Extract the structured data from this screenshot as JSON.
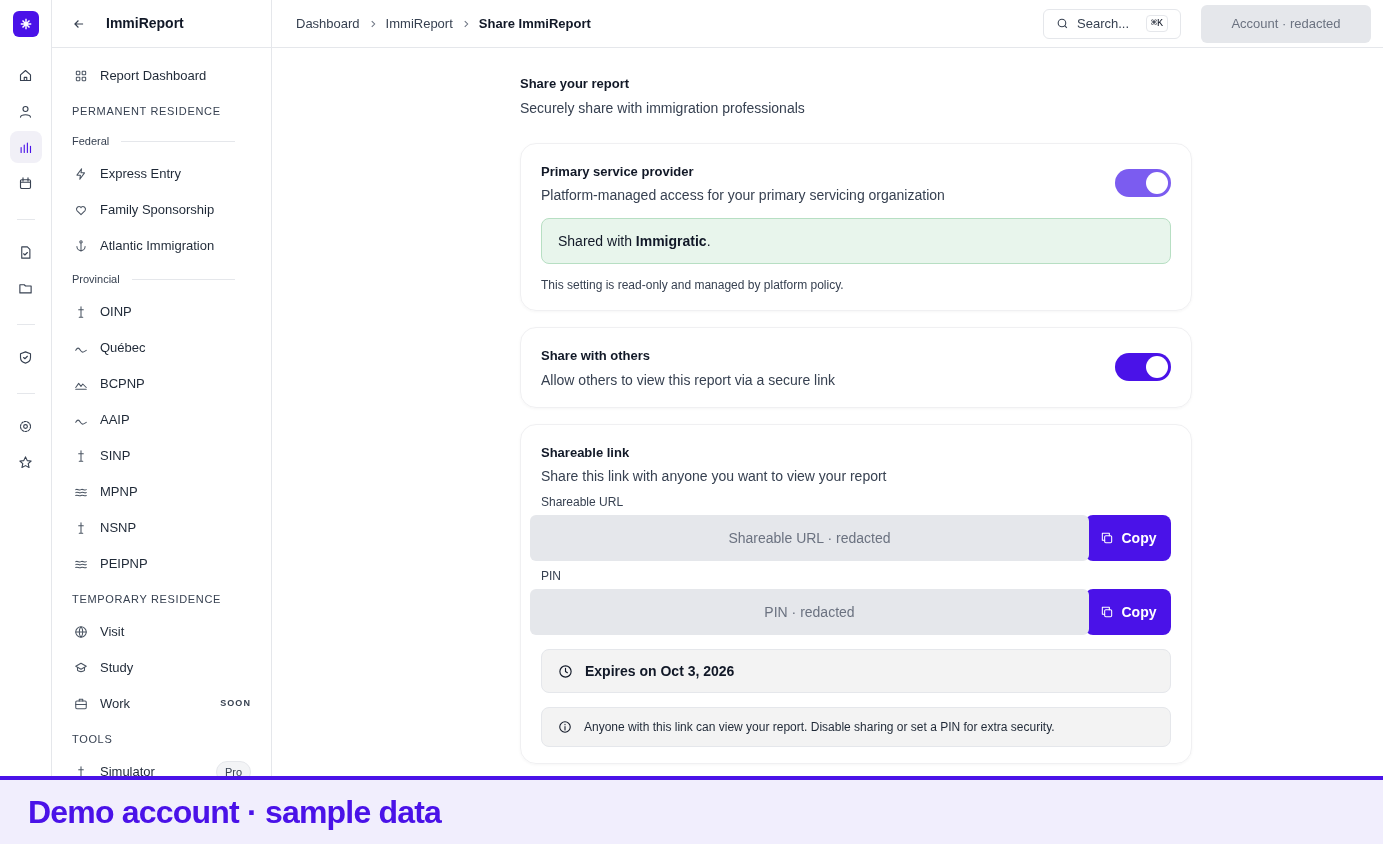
{
  "app": {
    "title": "ImmiReport"
  },
  "rail": [
    {
      "kind": "button",
      "selected": false
    },
    {
      "kind": "button",
      "selected": false
    },
    {
      "kind": "button",
      "selected": true
    },
    {
      "kind": "button",
      "selected": false
    },
    {
      "kind": "divider"
    },
    {
      "kind": "button",
      "selected": false
    },
    {
      "kind": "button",
      "selected": false
    },
    {
      "kind": "divider"
    },
    {
      "kind": "button",
      "selected": false
    },
    {
      "kind": "divider"
    },
    {
      "kind": "button",
      "selected": false
    },
    {
      "kind": "button",
      "selected": false
    }
  ],
  "sidebar": [
    {
      "kind": "item",
      "label": "Report Dashboard"
    },
    {
      "kind": "section",
      "label": "PERMANENT RESIDENCE"
    },
    {
      "kind": "group",
      "label": "Federal"
    },
    {
      "kind": "item",
      "label": "Express Entry"
    },
    {
      "kind": "item",
      "label": "Family Sponsorship"
    },
    {
      "kind": "item",
      "label": "Atlantic Immigration"
    },
    {
      "kind": "group",
      "label": "Provincial"
    },
    {
      "kind": "item",
      "label": "OINP"
    },
    {
      "kind": "item",
      "label": "Québec"
    },
    {
      "kind": "item",
      "label": "BCPNP"
    },
    {
      "kind": "item",
      "label": "AAIP"
    },
    {
      "kind": "item",
      "label": "SINP"
    },
    {
      "kind": "item",
      "label": "MPNP"
    },
    {
      "kind": "item",
      "label": "NSNP"
    },
    {
      "kind": "item",
      "label": "PEIPNP"
    },
    {
      "kind": "section",
      "label": "TEMPORARY RESIDENCE"
    },
    {
      "kind": "item",
      "label": "Visit"
    },
    {
      "kind": "item",
      "label": "Study"
    },
    {
      "kind": "item",
      "label": "Work",
      "badge": "SOON"
    },
    {
      "kind": "section",
      "label": "TOOLS"
    },
    {
      "kind": "item",
      "label": "Simulator",
      "pill": "Pro"
    }
  ],
  "breadcrumbs": [
    "Dashboard",
    "ImmiReport",
    "Share ImmiReport"
  ],
  "search": {
    "placeholder": "Search...",
    "shortcut": "⌘K"
  },
  "account": "Account · redacted",
  "heading": {
    "title": "Share your report",
    "subtitle": "Securely share with immigration professionals"
  },
  "cards": [
    {
      "kind": "toggle",
      "title": "Primary service provider",
      "description": "Platform-managed access for your primary servicing organization",
      "on": true,
      "disabled": true,
      "notice": "Shared with **Immigratic**.",
      "note": "This setting is read-only and managed by platform policy."
    },
    {
      "kind": "toggle",
      "title": "Share with others",
      "description": "Allow others to view this report via a secure link",
      "on": true,
      "disabled": false
    },
    {
      "kind": "link",
      "title": "Shareable link",
      "description": "Share this link with anyone you want to view your report",
      "fields": [
        {
          "label": "Shareable URL",
          "value": "Shareable URL · redacted",
          "button": "Copy"
        },
        {
          "label": "PIN",
          "value": "PIN · redacted",
          "button": "Copy"
        }
      ],
      "expires": "Expires on Oct 3, 2026",
      "info": "Anyone with this link can view your report. Disable sharing or set a PIN for extra security."
    }
  ],
  "banner": "Demo account · sample data"
}
